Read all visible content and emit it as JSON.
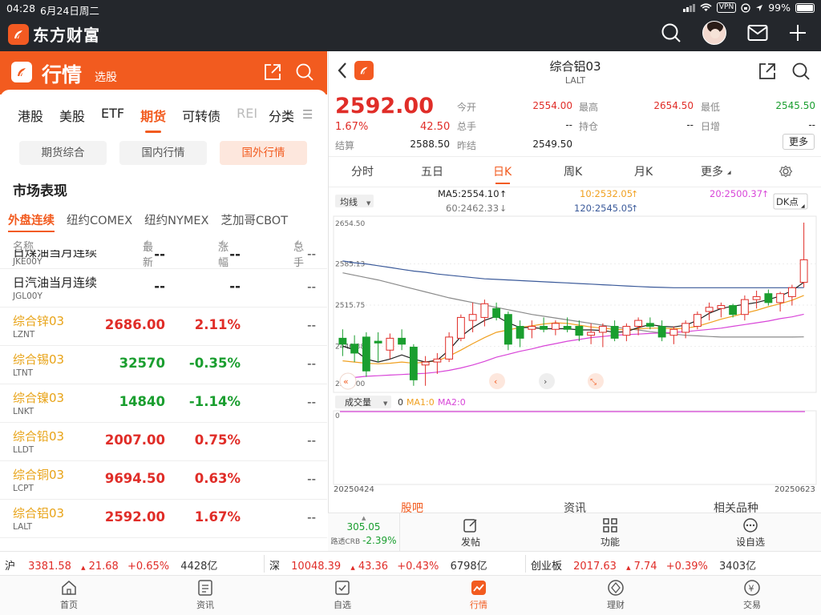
{
  "status_bar": {
    "time": "04:28",
    "date": "6月24日周二",
    "vpn": "VPN",
    "battery": "99%",
    "battery_level": 0.99
  },
  "app": {
    "name": "东方财富",
    "icons": [
      "search-icon",
      "avatar",
      "mail-icon",
      "plus-icon"
    ]
  },
  "left": {
    "header_title": "行情",
    "header_sub": "选股",
    "market_tabs": [
      "港股",
      "美股",
      "ETF",
      "期货",
      "可转债",
      "REI"
    ],
    "active_market_tab": "期货",
    "category_label": "分类",
    "menu_glyph": "☰",
    "futures_tabs": [
      "期货综合",
      "国内行情",
      "国外行情"
    ],
    "active_futures_tab": "国外行情",
    "section_title": "市场表现",
    "sub_tabs": [
      "外盘连续",
      "纽约COMEX",
      "纽约NYMEX",
      "芝加哥CBOT"
    ],
    "active_sub_tab": "外盘连续",
    "table_headers": {
      "name": "名称",
      "price": "最新",
      "change": "涨幅",
      "total": "总手"
    },
    "rows": [
      {
        "name": "日煤油当月连续",
        "code": "JKE00Y",
        "price": "--",
        "change": "--",
        "total": "--",
        "color": "plain",
        "cut": true
      },
      {
        "name": "日汽油当月连续",
        "code": "JGL00Y",
        "price": "--",
        "change": "--",
        "total": "--",
        "color": "plain"
      },
      {
        "name": "综合锌03",
        "code": "LZNT",
        "price": "2686.00",
        "change": "2.11%",
        "total": "--",
        "color": "up"
      },
      {
        "name": "综合锡03",
        "code": "LTNT",
        "price": "32570",
        "change": "-0.35%",
        "total": "--",
        "color": "down"
      },
      {
        "name": "综合镍03",
        "code": "LNKT",
        "price": "14840",
        "change": "-1.14%",
        "total": "--",
        "color": "down"
      },
      {
        "name": "综合铅03",
        "code": "LLDT",
        "price": "2007.00",
        "change": "0.75%",
        "total": "--",
        "color": "up"
      },
      {
        "name": "综合铜03",
        "code": "LCPT",
        "price": "9694.50",
        "change": "0.63%",
        "total": "--",
        "color": "up"
      },
      {
        "name": "综合铝03",
        "code": "LALT",
        "price": "2592.00",
        "change": "1.67%",
        "total": "--",
        "color": "up"
      }
    ]
  },
  "right": {
    "title": "综合铝03",
    "code": "LALT",
    "price": "2592.00",
    "pct": "1.67%",
    "change": "42.50",
    "fields": [
      {
        "label": "今开",
        "value": "2554.00",
        "color": "up"
      },
      {
        "label": "最高",
        "value": "2654.50",
        "color": "up"
      },
      {
        "label": "最低",
        "value": "2545.50",
        "color": "down"
      },
      {
        "label": "总手",
        "value": "--",
        "color": "plain"
      },
      {
        "label": "持仓",
        "value": "--",
        "color": "plain"
      },
      {
        "label": "日增",
        "value": "--",
        "color": "plain"
      },
      {
        "label": "结算",
        "value": "2588.50",
        "color": "plain"
      },
      {
        "label": "昨结",
        "value": "2549.50",
        "color": "plain"
      }
    ],
    "more_label": "更多",
    "period_tabs": [
      "分时",
      "五日",
      "日K",
      "周K",
      "月K",
      "更多"
    ],
    "active_period": "日K",
    "ma_selector": "均线",
    "ma_values": {
      "ma5": "MA5:2554.10",
      "ma10": "10:2532.05",
      "ma20": "20:2500.37",
      "ma60": "60:2462.33",
      "ma120": "120:2545.05"
    },
    "dk_button": "DK点",
    "volume_selector": "成交量",
    "volume_label": "0",
    "volume_ma1": "MA1:0",
    "volume_ma2": "MA2:0",
    "volume_axis": "0",
    "bottom_tabs": [
      "股吧",
      "资讯",
      "相关品种"
    ],
    "active_bottom_tab": "股吧"
  },
  "chart_data": {
    "type": "candlestick",
    "title": "",
    "y_ticks": [
      "2654.50",
      "2585.13",
      "2515.75",
      "2446.38",
      "2377.00"
    ],
    "ylim": [
      2377.0,
      2654.5
    ],
    "x_start": "20250424",
    "x_end": "20250623",
    "colors": {
      "up": "#e02d28",
      "down": "#1a9e2f",
      "ma5": "#222222",
      "ma10": "#f0a020",
      "ma20": "#d845d8",
      "ma60": "#8a8a8a",
      "ma120": "#3b5a9a"
    },
    "candles": [
      [
        2460,
        2475,
        2430,
        2450
      ],
      [
        2450,
        2465,
        2420,
        2435
      ],
      [
        2462,
        2470,
        2395,
        2405
      ],
      [
        2455,
        2470,
        2420,
        2452
      ],
      [
        2440,
        2468,
        2425,
        2460
      ],
      [
        2460,
        2475,
        2440,
        2450
      ],
      [
        2445,
        2450,
        2380,
        2390
      ],
      [
        2415,
        2430,
        2380,
        2420
      ],
      [
        2420,
        2435,
        2400,
        2425
      ],
      [
        2425,
        2470,
        2420,
        2462
      ],
      [
        2460,
        2500,
        2455,
        2495
      ],
      [
        2490,
        2520,
        2470,
        2500
      ],
      [
        2495,
        2525,
        2480,
        2518
      ],
      [
        2510,
        2520,
        2490,
        2495
      ],
      [
        2500,
        2505,
        2440,
        2450
      ],
      [
        2480,
        2490,
        2445,
        2460
      ],
      [
        2475,
        2490,
        2460,
        2480
      ],
      [
        2480,
        2495,
        2470,
        2475
      ],
      [
        2475,
        2490,
        2465,
        2485
      ],
      [
        2480,
        2495,
        2470,
        2475
      ],
      [
        2480,
        2490,
        2455,
        2465
      ],
      [
        2465,
        2485,
        2450,
        2470
      ],
      [
        2470,
        2485,
        2445,
        2480
      ],
      [
        2480,
        2490,
        2455,
        2460
      ],
      [
        2465,
        2485,
        2455,
        2480
      ],
      [
        2480,
        2495,
        2465,
        2490
      ],
      [
        2485,
        2495,
        2475,
        2480
      ],
      [
        2480,
        2490,
        2455,
        2462
      ],
      [
        2465,
        2480,
        2450,
        2475
      ],
      [
        2470,
        2490,
        2460,
        2485
      ],
      [
        2480,
        2505,
        2475,
        2500
      ],
      [
        2505,
        2520,
        2490,
        2512
      ],
      [
        2510,
        2520,
        2495,
        2515
      ],
      [
        2515,
        2518,
        2495,
        2500
      ],
      [
        2500,
        2532,
        2490,
        2525
      ],
      [
        2525,
        2540,
        2510,
        2530
      ],
      [
        2535,
        2542,
        2515,
        2520
      ],
      [
        2520,
        2538,
        2505,
        2535
      ],
      [
        2530,
        2550,
        2515,
        2545
      ],
      [
        2554,
        2654.5,
        2545.5,
        2592
      ]
    ],
    "ma_lines": {
      "ma5": [
        2447,
        2440,
        2425,
        2420,
        2425,
        2432,
        2425,
        2420,
        2423,
        2440,
        2463,
        2478,
        2490,
        2497,
        2486,
        2478,
        2478,
        2476,
        2476,
        2476,
        2474,
        2474,
        2473,
        2470,
        2471,
        2478,
        2483,
        2480,
        2479,
        2482,
        2490,
        2502,
        2510,
        2514,
        2517,
        2520,
        2525,
        2531,
        2540,
        2554.1
      ],
      "ma10": [
        2422,
        2420,
        2418,
        2417,
        2418,
        2420,
        2418,
        2420,
        2422,
        2430,
        2440,
        2451,
        2461,
        2470,
        2474,
        2478,
        2481,
        2484,
        2486,
        2485,
        2482,
        2479,
        2477,
        2475,
        2474,
        2476,
        2477,
        2477,
        2476,
        2477,
        2480,
        2486,
        2492,
        2497,
        2502,
        2507,
        2513,
        2518,
        2524,
        2532.05
      ],
      "ma20": [
        2392,
        2394,
        2396,
        2397,
        2398,
        2399,
        2400,
        2401,
        2403,
        2406,
        2410,
        2415,
        2421,
        2428,
        2433,
        2438,
        2442,
        2447,
        2451,
        2455,
        2458,
        2461,
        2463,
        2465,
        2466,
        2467,
        2468,
        2469,
        2470,
        2471,
        2473,
        2475,
        2477,
        2480,
        2483,
        2486,
        2489,
        2493,
        2496,
        2500.37
      ],
      "ma60": [
        2570,
        2566,
        2562,
        2558,
        2553,
        2548,
        2543,
        2538,
        2533,
        2528,
        2524,
        2520,
        2516,
        2512,
        2508,
        2504,
        2500,
        2497,
        2494,
        2491,
        2488,
        2485,
        2482,
        2479,
        2476,
        2474,
        2471,
        2469,
        2467,
        2465,
        2464,
        2463,
        2462,
        2462,
        2462,
        2462,
        2462,
        2462,
        2462,
        2462.33
      ],
      "ma120": [
        2590,
        2587,
        2585,
        2582,
        2579,
        2576,
        2573,
        2571,
        2568,
        2566,
        2564,
        2562,
        2560,
        2559,
        2558,
        2557,
        2556,
        2555,
        2554,
        2553,
        2552,
        2551,
        2550,
        2549,
        2548,
        2547,
        2546,
        2545.5,
        2545,
        2545,
        2545,
        2545,
        2545,
        2545,
        2545,
        2545,
        2545,
        2545,
        2545,
        2545.05
      ]
    },
    "volume_ma2_color": "#d845d8"
  },
  "action_bar": {
    "related_price": "305.05",
    "related_name": "路透CRB",
    "related_change": "-2.39%",
    "buttons": [
      "发帖",
      "功能",
      "设自选"
    ]
  },
  "index_bar": [
    {
      "name": "沪",
      "value": "3381.58",
      "change": "21.68",
      "pct": "+0.65%",
      "amount": "4428亿"
    },
    {
      "name": "深",
      "value": "10048.39",
      "change": "43.36",
      "pct": "+0.43%",
      "amount": "6798亿"
    },
    {
      "name": "创业板",
      "value": "2017.63",
      "change": "7.74",
      "pct": "+0.39%",
      "amount": "3403亿"
    }
  ],
  "nav": [
    "首页",
    "资讯",
    "自选",
    "行情",
    "理财",
    "交易"
  ],
  "active_nav": "行情"
}
